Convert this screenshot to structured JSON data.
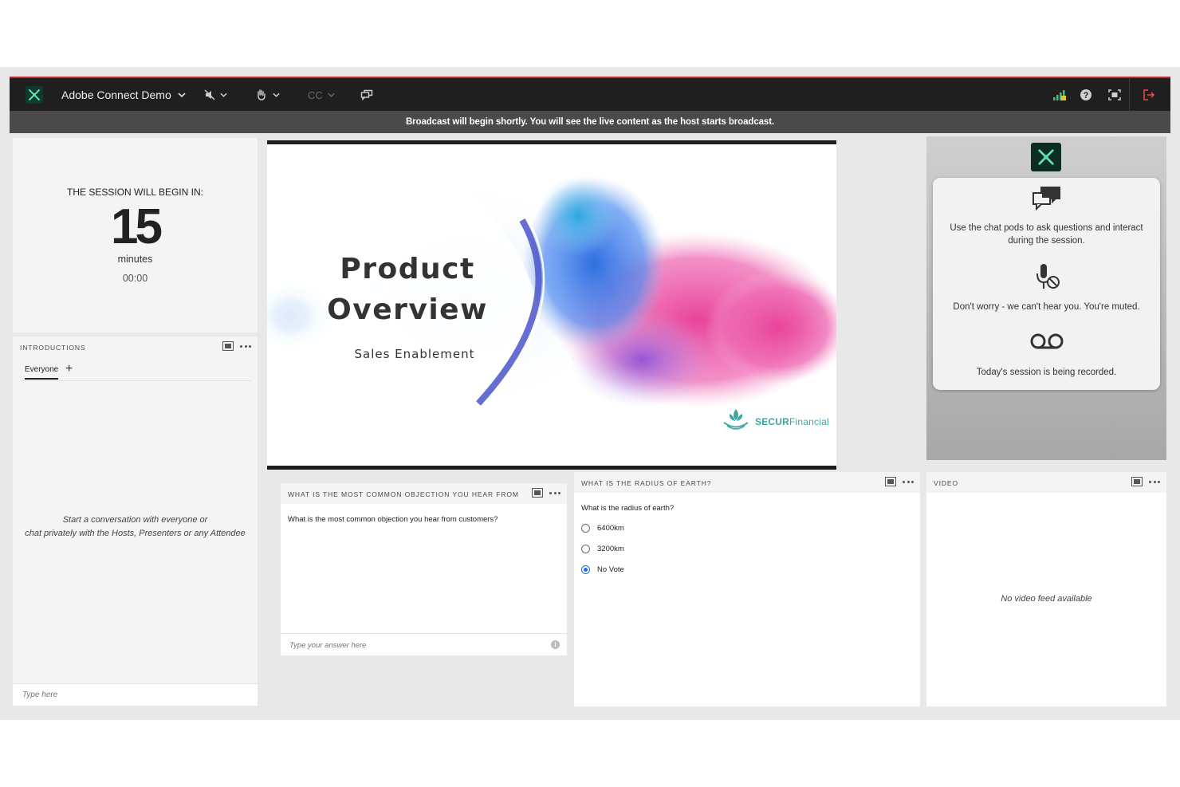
{
  "toolbar": {
    "meeting_title": "Adobe Connect Demo",
    "cc_label": "CC"
  },
  "banner": {
    "text": "Broadcast will begin shortly. You will see the live content as the host starts broadcast."
  },
  "countdown": {
    "label": "THE SESSION WILL BEGIN IN:",
    "number": "15",
    "unit": "minutes",
    "time": "00:00"
  },
  "chat": {
    "title": "INTRODUCTIONS",
    "tab": "Everyone",
    "add_symbol": "+",
    "empty_line1": "Start a conversation with everyone or",
    "empty_line2": "chat privately with the Hosts, Presenters or any Attendee",
    "placeholder": "Type here"
  },
  "slide": {
    "title_line1": "Product",
    "title_line2": "Overview",
    "subtitle": "Sales Enablement",
    "brand_bold": "SECUR",
    "brand_light": "Financial"
  },
  "info": {
    "chat_text": "Use the chat pods to ask questions and interact during the session.",
    "mute_text": "Don't worry - we can't hear you. You're muted.",
    "record_text": "Today's session is being recorded."
  },
  "poll1": {
    "title": "WHAT IS THE MOST COMMON OBJECTION YOU HEAR FROM CUS...",
    "question": "What is the most common objection you hear from customers?",
    "placeholder": "Type your answer here"
  },
  "poll2": {
    "title": "WHAT IS THE RADIUS OF EARTH?",
    "question": "What is the radius of earth?",
    "options": [
      "6400km",
      "3200km",
      "No Vote"
    ],
    "selected_index": 2
  },
  "video": {
    "title": "VIDEO",
    "empty": "No video feed available"
  },
  "colors": {
    "toolbar_bg": "#1f1f1f",
    "accent_red": "#c0292b",
    "radio_blue": "#1473e6",
    "brand_teal": "#3aa7a2",
    "pink": "#e8449a",
    "blue": "#2f6ee0"
  }
}
